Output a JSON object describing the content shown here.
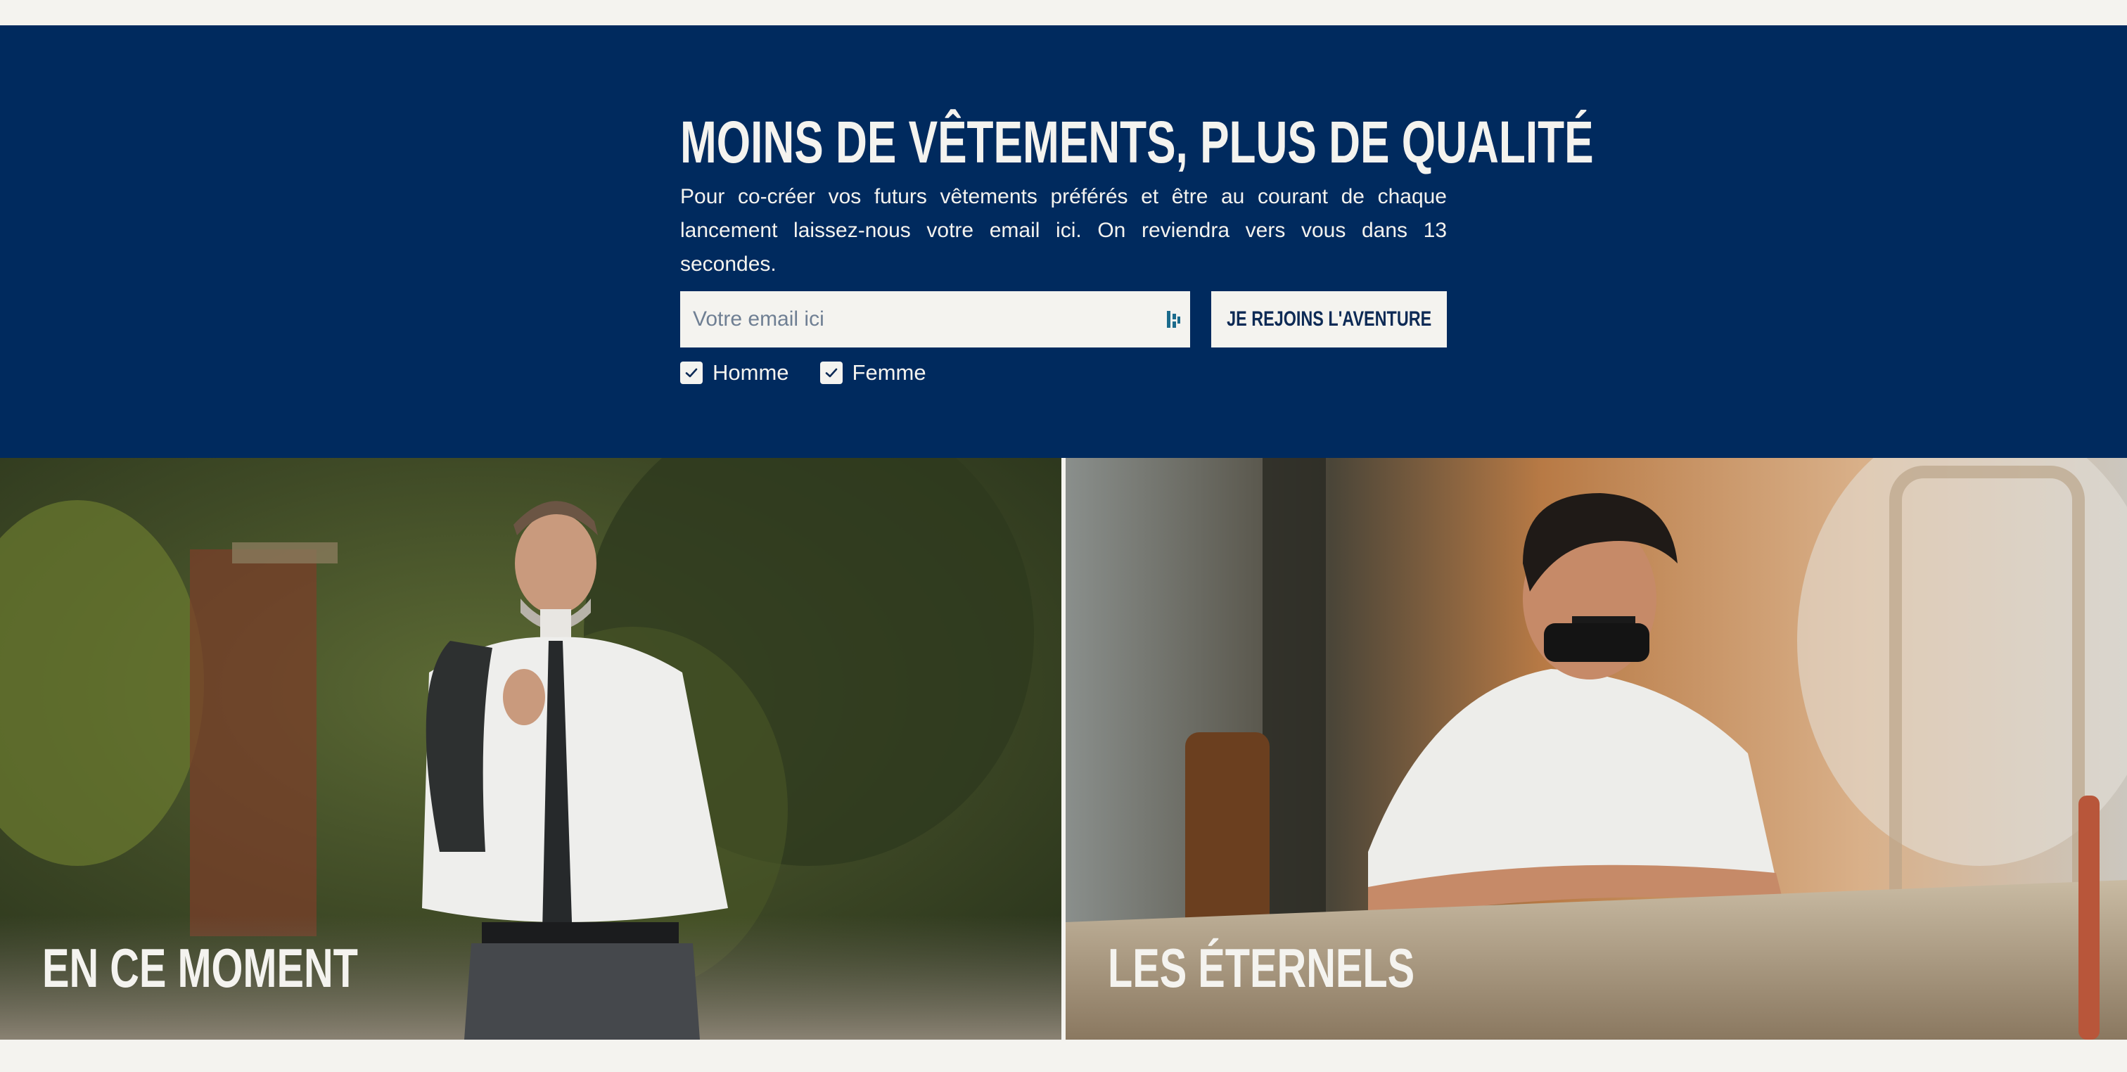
{
  "newsletter": {
    "title": "MOINS DE VÊTEMENTS, PLUS DE QUALITÉ",
    "description": "Pour co-créer vos futurs vêtements préférés et être au courant de chaque lancement laissez-nous votre email ici. On reviendra vers vous dans 13 secondes.",
    "email_placeholder": "Votre email ici",
    "email_value": "",
    "submit_label": "JE REJOINS L'AVENTURE",
    "options": [
      {
        "label": "Homme",
        "checked": true
      },
      {
        "label": "Femme",
        "checked": true
      }
    ]
  },
  "panels": [
    {
      "label": "EN CE MOMENT"
    },
    {
      "label": "LES ÉTERNELS"
    }
  ],
  "colors": {
    "navy": "#002a5e",
    "cream": "#f4f3ef",
    "button_text": "#0d2a55"
  }
}
